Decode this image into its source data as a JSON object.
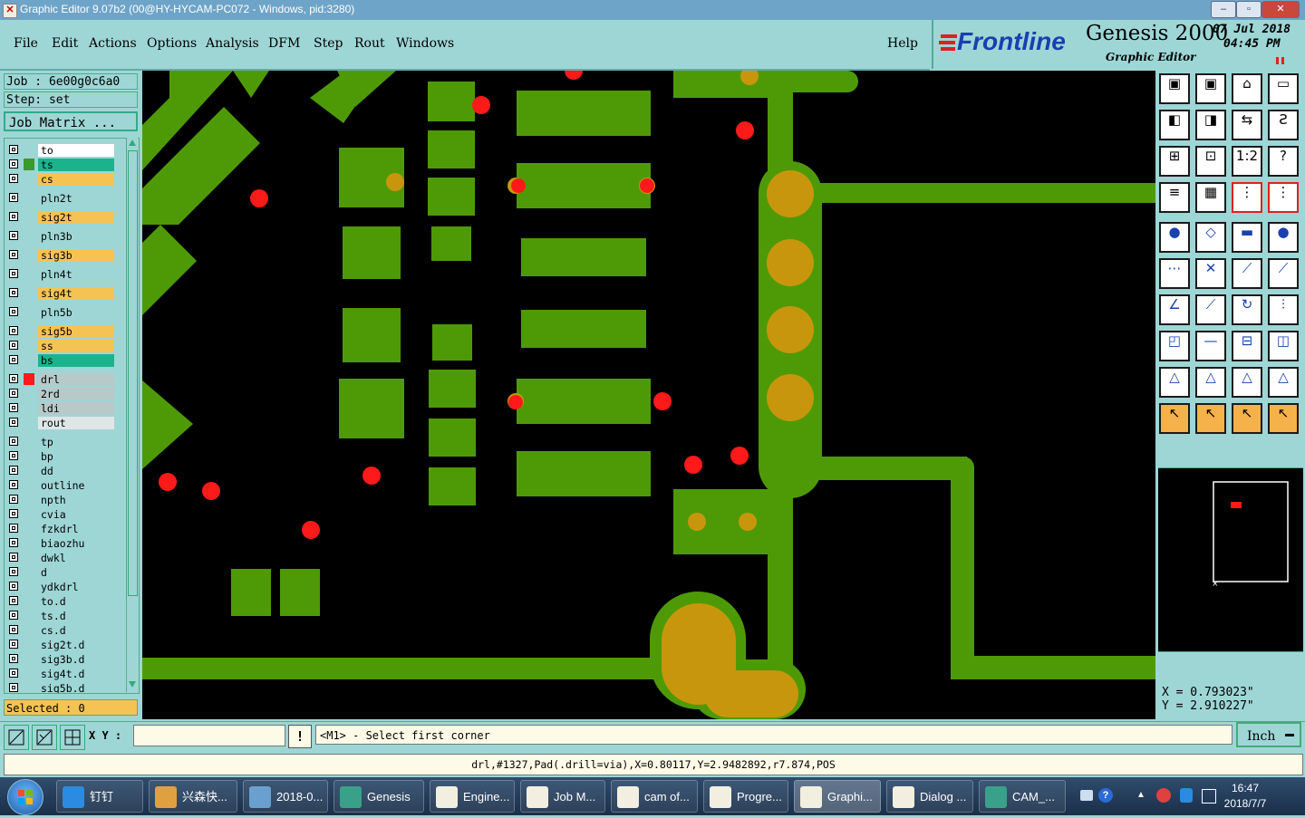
{
  "window": {
    "title": "Graphic Editor 9.07b2 (00@HY-HYCAM-PC072 - Windows, pid:3280)",
    "min_label": "–",
    "max_label": "▫",
    "close_label": "✕"
  },
  "menu": {
    "items": [
      "File",
      "Edit",
      "Actions",
      "Options",
      "Analysis",
      "DFM",
      "Step",
      "Rout",
      "Windows"
    ],
    "help": "Help"
  },
  "logo": {
    "brand": "Frontline",
    "product": "Genesis 2000",
    "subtitle": "Graphic Editor",
    "date": "07 Jul 2018",
    "time": "04:45 PM"
  },
  "job": {
    "job_label": "Job : 6e00g0c6a0",
    "step_label": "Step: set",
    "matrix_button": "Job Matrix ..."
  },
  "layers": [
    {
      "name": "to",
      "color": "#ffffff",
      "swatch": ""
    },
    {
      "name": "ts",
      "color": "#1bb38e",
      "swatch": "#3a9a2a"
    },
    {
      "name": "cs",
      "color": "#f5c354",
      "swatch": ""
    },
    {
      "name": "pln2t",
      "color": "#9ed6d6",
      "swatch": ""
    },
    {
      "name": "sig2t",
      "color": "#f5c354",
      "swatch": ""
    },
    {
      "name": "pln3b",
      "color": "#9ed6d6",
      "swatch": ""
    },
    {
      "name": "sig3b",
      "color": "#f5c354",
      "swatch": ""
    },
    {
      "name": "pln4t",
      "color": "#9ed6d6",
      "swatch": ""
    },
    {
      "name": "sig4t",
      "color": "#f5c354",
      "swatch": ""
    },
    {
      "name": "pln5b",
      "color": "#9ed6d6",
      "swatch": ""
    },
    {
      "name": "sig5b",
      "color": "#f5c354",
      "swatch": ""
    },
    {
      "name": "ss",
      "color": "#f5c354",
      "swatch": ""
    },
    {
      "name": "bs",
      "color": "#1bb38e",
      "swatch": ""
    },
    {
      "name": "drl",
      "color": "#b7c9c9",
      "swatch": "#ff1a1a"
    },
    {
      "name": "2rd",
      "color": "#b7c9c9",
      "swatch": ""
    },
    {
      "name": "ldi",
      "color": "#b7c9c9",
      "swatch": ""
    },
    {
      "name": "rout",
      "color": "#e0e6e6",
      "swatch": ""
    },
    {
      "name": "tp",
      "color": "#9ed6d6",
      "swatch": ""
    },
    {
      "name": "bp",
      "color": "#9ed6d6",
      "swatch": ""
    },
    {
      "name": "dd",
      "color": "#9ed6d6",
      "swatch": ""
    },
    {
      "name": "outline",
      "color": "#9ed6d6",
      "swatch": ""
    },
    {
      "name": "npth",
      "color": "#9ed6d6",
      "swatch": ""
    },
    {
      "name": "cvia",
      "color": "#9ed6d6",
      "swatch": ""
    },
    {
      "name": "fzkdrl",
      "color": "#9ed6d6",
      "swatch": ""
    },
    {
      "name": "biaozhu",
      "color": "#9ed6d6",
      "swatch": ""
    },
    {
      "name": "dwkl",
      "color": "#9ed6d6",
      "swatch": ""
    },
    {
      "name": "d",
      "color": "#9ed6d6",
      "swatch": ""
    },
    {
      "name": "ydkdrl",
      "color": "#9ed6d6",
      "swatch": ""
    },
    {
      "name": "to.d",
      "color": "#9ed6d6",
      "swatch": ""
    },
    {
      "name": "ts.d",
      "color": "#9ed6d6",
      "swatch": ""
    },
    {
      "name": "cs.d",
      "color": "#9ed6d6",
      "swatch": ""
    },
    {
      "name": "sig2t.d",
      "color": "#9ed6d6",
      "swatch": ""
    },
    {
      "name": "sig3b.d",
      "color": "#9ed6d6",
      "swatch": ""
    },
    {
      "name": "sig4t.d",
      "color": "#9ed6d6",
      "swatch": ""
    },
    {
      "name": "sig5b.d",
      "color": "#9ed6d6",
      "swatch": ""
    }
  ],
  "selected": "Selected : 0",
  "coords": {
    "x": "X = 0.793023\"",
    "y": "Y = 2.910227\""
  },
  "command": {
    "xy_label": "X Y :",
    "prompt": "<M1> - Select first corner",
    "unit": "Inch"
  },
  "status": "drl,#1327,Pad(.drill=via),X=0.80117,Y=2.9482892,r7.874,POS",
  "taskbar": {
    "items": [
      {
        "label": "钉钉",
        "color": "#2a8be0"
      },
      {
        "label": "兴森快...",
        "color": "#e0a040"
      },
      {
        "label": "2018-0...",
        "color": "#6aa0d0"
      },
      {
        "label": "Genesis",
        "color": "#3aa08a"
      },
      {
        "label": "Engine...",
        "color": "#f2eee0"
      },
      {
        "label": "Job M...",
        "color": "#f2eee0"
      },
      {
        "label": "cam of...",
        "color": "#f2eee0"
      },
      {
        "label": "Progre...",
        "color": "#f2eee0"
      },
      {
        "label": "Graphi...",
        "color": "#f2eee0"
      },
      {
        "label": "Dialog ...",
        "color": "#f2eee0"
      },
      {
        "label": "CAM_...",
        "color": "#3aa08a"
      }
    ],
    "time": "16:47",
    "date": "2018/7/7"
  },
  "colors": {
    "copper": "#4e9a06",
    "drill": "#ff1a1a",
    "via_pad": "#c8960c",
    "background": "#000000"
  }
}
